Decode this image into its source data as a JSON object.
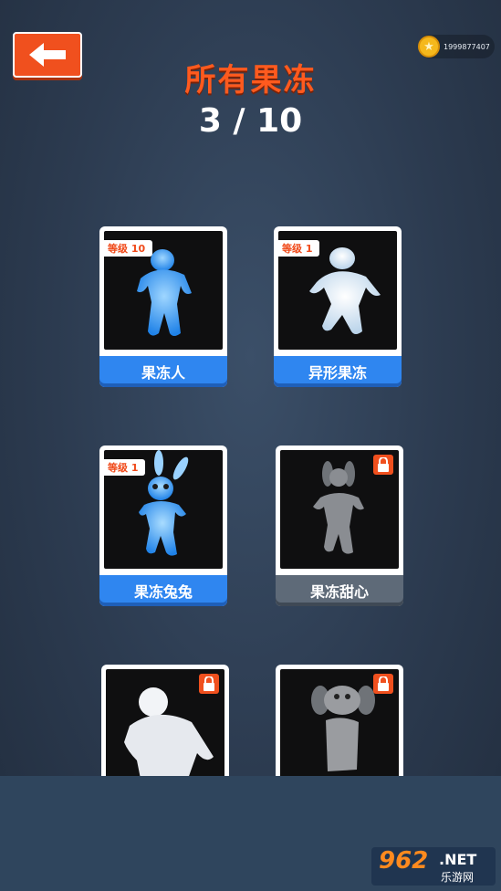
{
  "header": {
    "back_icon": "arrow-left-icon",
    "coin_icon": "star-coin-icon",
    "coins": "1999877407",
    "title": "所有果冻",
    "progress": "3 / 10"
  },
  "cards": [
    {
      "name": "果冻人",
      "level": "等级 10",
      "locked": false,
      "color": "#3aa0f5"
    },
    {
      "name": "异形果冻",
      "level": "等级 1",
      "locked": false,
      "color": "#e8f2fb"
    },
    {
      "name": "果冻兔兔",
      "level": "等级 1",
      "locked": false,
      "color": "#3aa0f5"
    },
    {
      "name": "果冻甜心",
      "level": "",
      "locked": true,
      "color": "#8a8d92"
    },
    {
      "name": "",
      "level": "",
      "locked": true,
      "color": "#f2f4f7"
    },
    {
      "name": "",
      "level": "",
      "locked": true,
      "color": "#9a9ca0"
    }
  ],
  "watermark": {
    "num": "962",
    "net": ".NET",
    "cn": "乐游网"
  },
  "colors": {
    "accent": "#f0501e",
    "blue": "#2f86f0",
    "locked": "#5e6a78"
  }
}
